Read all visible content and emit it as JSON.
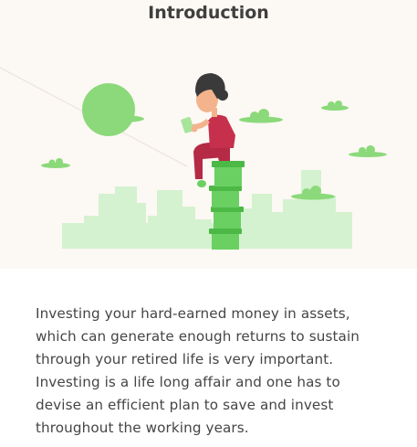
{
  "header": {
    "title": "Introduction"
  },
  "illustration": {
    "subject": "person-sitting-on-stack-of-coins-reading-phone",
    "colors": {
      "background": "#fcf8f3",
      "skyline": "#d4f2cf",
      "cloud": "#8bd97a",
      "sun": "#8bd97a",
      "coin": "#6ad062",
      "coin_dark": "#4cb845",
      "shirt": "#c6304c",
      "pants": "#b52a45",
      "skin": "#f2b38d",
      "hair": "#3a3a3a",
      "phone": "#a8e59b"
    }
  },
  "body": {
    "paragraph_lines": [
      "Investing your hard-earned money in assets,",
      "which can generate enough returns to sustain",
      "through your retired life is very important.",
      "Investing is a life long affair and one has to",
      "devise an efficient plan to save and invest",
      "throughout the working years."
    ]
  }
}
